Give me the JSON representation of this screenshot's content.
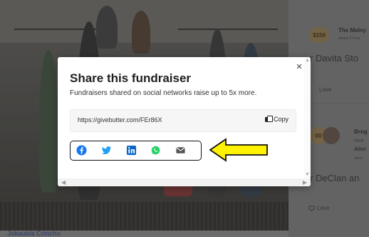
{
  "background": {
    "photo_caption": "Jokaukia Crinchu",
    "feed": {
      "donation_amount": "$150",
      "donor_name": "The Melny",
      "donor_time": "about 3 hour",
      "message_1": "r Davita Sto",
      "love_label_1": "Love",
      "comment_initials": "00",
      "comment_name": "Brog",
      "comment_line_1": "rece",
      "comment_line_2": "Alice",
      "comment_line_3": "abou",
      "message_2": "r DeClan an",
      "love_label_2": "Love"
    }
  },
  "modal": {
    "title": "Share this fundraiser",
    "subtitle": "Fundraisers shared on social networks raise up to 5x more.",
    "share_url": "https://givebutter.com/FEr86X",
    "copy_label": "Copy",
    "close_icon": "×",
    "share_buttons": [
      {
        "name": "facebook",
        "icon": "facebook-icon",
        "color": "#1877f2"
      },
      {
        "name": "twitter",
        "icon": "twitter-icon",
        "color": "#1da1f2"
      },
      {
        "name": "linkedin",
        "icon": "linkedin-icon",
        "color": "#0a66c2"
      },
      {
        "name": "whatsapp",
        "icon": "whatsapp-icon",
        "color": "#25d366"
      },
      {
        "name": "email",
        "icon": "email-icon",
        "color": "#555555"
      }
    ]
  },
  "annotation": {
    "arrow_color": "#fff200",
    "box_color": "#111111"
  }
}
